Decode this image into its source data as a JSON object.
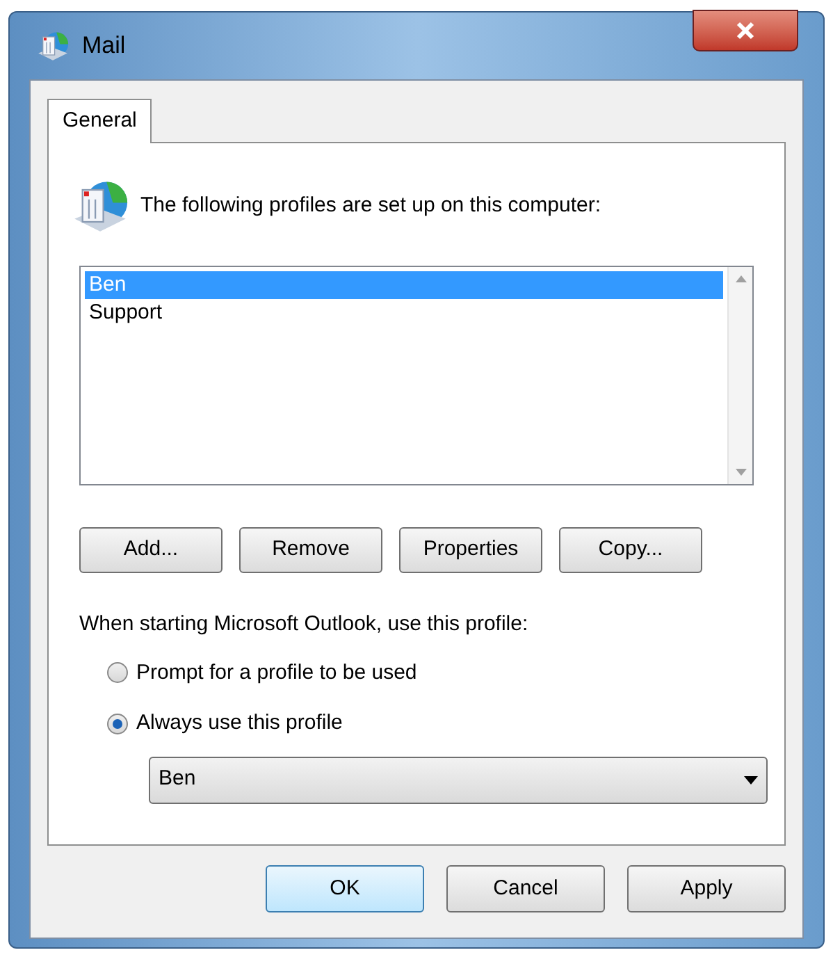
{
  "window": {
    "title": "Mail"
  },
  "tabs": [
    {
      "label": "General",
      "selected": true
    }
  ],
  "intro": "The following profiles are set up on this computer:",
  "profiles": [
    {
      "name": "Ben",
      "selected": true
    },
    {
      "name": "Support",
      "selected": false
    }
  ],
  "profile_buttons": [
    "Add...",
    "Remove",
    "Properties",
    "Copy..."
  ],
  "startup_label": "When starting Microsoft Outlook, use this profile:",
  "startup_options": [
    {
      "label": "Prompt for a profile to be used",
      "selected": false
    },
    {
      "label": "Always use this profile",
      "selected": true
    }
  ],
  "profile_dropdown": {
    "value": "Ben"
  },
  "dialog_buttons": [
    {
      "label": "OK",
      "default": true
    },
    {
      "label": "Cancel",
      "default": false
    },
    {
      "label": "Apply",
      "default": false
    }
  ]
}
